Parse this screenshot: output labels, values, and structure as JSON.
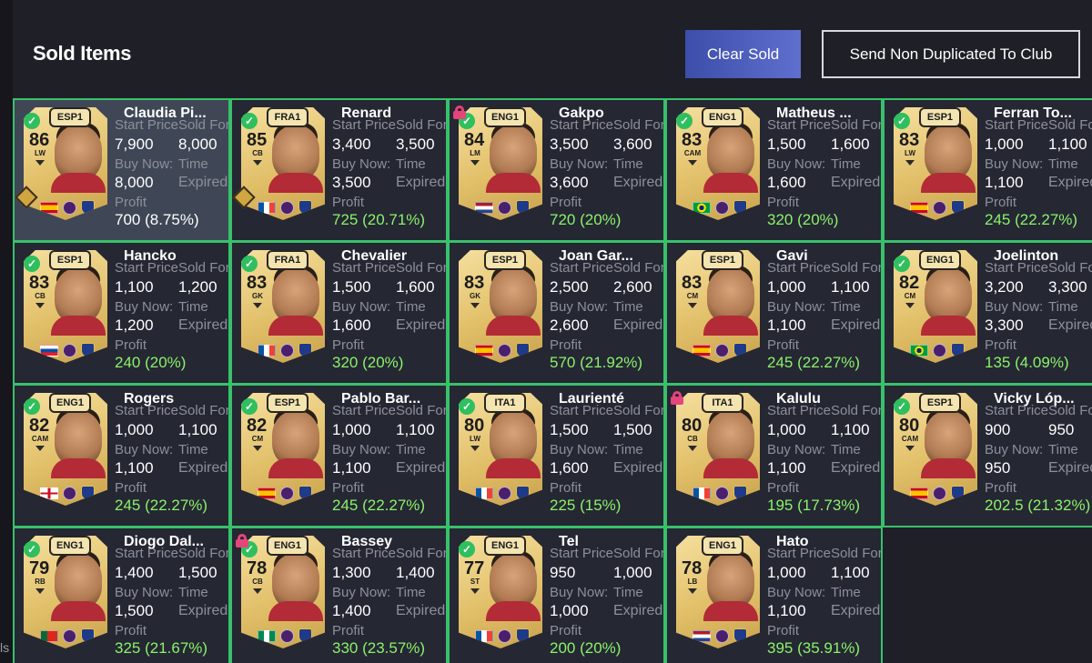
{
  "side_text": "ls",
  "title": "Sold Items",
  "buttons": {
    "clear_sold": "Clear Sold",
    "send_non_duplicated": "Send Non Duplicated To Club"
  },
  "labels": {
    "start_price": "Start Price",
    "sold_for": "Sold For",
    "buy_now": "Buy Now:",
    "time": "Time",
    "expired": "Expired",
    "profit": "Profit"
  },
  "colors": {
    "accent_border": "#38c16a",
    "profit_green": "#8af36a",
    "button_gradient_start": "#3b4ea8",
    "button_gradient_end": "#5f6fcf"
  },
  "items": [
    {
      "name": "Claudia Pi...",
      "league": "ESP1",
      "rating": "86",
      "pos": "LW",
      "start": "7,900",
      "sold": "8,000",
      "buy": "8,000",
      "profit": "700 (8.75%)",
      "profit_white": true,
      "selected": true,
      "check": true,
      "lock": false,
      "evo": true,
      "flags": [
        "es",
        "liga-f",
        "barca"
      ]
    },
    {
      "name": "Renard",
      "league": "FRA1",
      "rating": "85",
      "pos": "CB",
      "start": "3,400",
      "sold": "3,500",
      "buy": "3,500",
      "profit": "725 (20.71%)",
      "check": true,
      "evo": true,
      "flags": [
        "fr",
        "ligue",
        "lyon"
      ]
    },
    {
      "name": "Gakpo",
      "league": "ENG1",
      "rating": "84",
      "pos": "LM",
      "start": "3,500",
      "sold": "3,600",
      "buy": "3,600",
      "profit": "720 (20%)",
      "check": true,
      "lock": true,
      "flags": [
        "nl",
        "pl",
        "lfc"
      ]
    },
    {
      "name": "Matheus ...",
      "league": "ENG1",
      "rating": "83",
      "pos": "CAM",
      "start": "1,500",
      "sold": "1,600",
      "buy": "1,600",
      "profit": "320 (20%)",
      "check": true,
      "flags": [
        "br",
        "pl",
        "manu"
      ]
    },
    {
      "name": "Ferran To...",
      "league": "ESP1",
      "rating": "83",
      "pos": "LW",
      "start": "1,000",
      "sold": "1,100",
      "buy": "1,100",
      "profit": "245 (22.27%)",
      "check": true,
      "flags": [
        "es",
        "laliga",
        "barca"
      ]
    },
    {
      "name": "Hancko",
      "league": "ESP1",
      "rating": "83",
      "pos": "CB",
      "start": "1,100",
      "sold": "1,200",
      "buy": "1,200",
      "profit": "240 (20%)",
      "check": true,
      "flags": [
        "sk",
        "laliga",
        "atm"
      ]
    },
    {
      "name": "Chevalier",
      "league": "FRA1",
      "rating": "83",
      "pos": "GK",
      "start": "1,500",
      "sold": "1,600",
      "buy": "1,600",
      "profit": "320 (20%)",
      "check": true,
      "flags": [
        "fr",
        "ligue",
        "psg"
      ]
    },
    {
      "name": "Joan Gar...",
      "league": "ESP1",
      "rating": "83",
      "pos": "GK",
      "start": "2,500",
      "sold": "2,600",
      "buy": "2,600",
      "profit": "570 (21.92%)",
      "check": false,
      "flags": [
        "es",
        "laliga",
        "barca"
      ]
    },
    {
      "name": "Gavi",
      "league": "ESP1",
      "rating": "83",
      "pos": "CM",
      "start": "1,000",
      "sold": "1,100",
      "buy": "1,100",
      "profit": "245 (22.27%)",
      "check": false,
      "flags": [
        "es",
        "laliga",
        "barca"
      ]
    },
    {
      "name": "Joelinton",
      "league": "ENG1",
      "rating": "82",
      "pos": "CM",
      "start": "3,200",
      "sold": "3,300",
      "buy": "3,300",
      "profit": "135 (4.09%)",
      "check": true,
      "flags": [
        "br",
        "pl",
        "ncl"
      ]
    },
    {
      "name": "Rogers",
      "league": "ENG1",
      "rating": "82",
      "pos": "CAM",
      "start": "1,000",
      "sold": "1,100",
      "buy": "1,100",
      "profit": "245 (22.27%)",
      "check": true,
      "flags": [
        "en",
        "pl",
        "avl"
      ]
    },
    {
      "name": "Pablo Bar...",
      "league": "ESP1",
      "rating": "82",
      "pos": "CM",
      "start": "1,000",
      "sold": "1,100",
      "buy": "1,100",
      "profit": "245 (22.27%)",
      "check": true,
      "flags": [
        "es",
        "laliga",
        "atm"
      ]
    },
    {
      "name": "Laurienté",
      "league": "ITA1",
      "rating": "80",
      "pos": "LW",
      "start": "1,500",
      "sold": "1,500",
      "buy": "1,600",
      "profit": "225 (15%)",
      "check": true,
      "flags": [
        "fr",
        "serie",
        "sas"
      ]
    },
    {
      "name": "Kalulu",
      "league": "ITA1",
      "rating": "80",
      "pos": "CB",
      "start": "1,000",
      "sold": "1,100",
      "buy": "1,100",
      "profit": "195 (17.73%)",
      "check": false,
      "lock": true,
      "flags": [
        "fr",
        "serie",
        "juve"
      ]
    },
    {
      "name": "Vicky Lóp...",
      "league": "ESP1",
      "rating": "80",
      "pos": "CAM",
      "start": "900",
      "sold": "950",
      "buy": "950",
      "profit": "202.5 (21.32%)",
      "check": true,
      "flags": [
        "es",
        "liga-f",
        "barca"
      ]
    },
    {
      "name": "Diogo Dal...",
      "league": "ENG1",
      "rating": "79",
      "pos": "RB",
      "start": "1,400",
      "sold": "1,500",
      "buy": "1,500",
      "profit": "325 (21.67%)",
      "check": true,
      "flags": [
        "pt",
        "pl",
        "manu"
      ]
    },
    {
      "name": "Bassey",
      "league": "ENG1",
      "rating": "78",
      "pos": "CB",
      "start": "1,300",
      "sold": "1,400",
      "buy": "1,400",
      "profit": "330 (23.57%)",
      "check": true,
      "lock": true,
      "flags": [
        "ng",
        "pl",
        "ful"
      ]
    },
    {
      "name": "Tel",
      "league": "ENG1",
      "rating": "77",
      "pos": "ST",
      "start": "950",
      "sold": "1,000",
      "buy": "1,000",
      "profit": "200 (20%)",
      "check": true,
      "flags": [
        "fr",
        "pl",
        "tot"
      ]
    },
    {
      "name": "Hato",
      "league": "ENG1",
      "rating": "78",
      "pos": "LB",
      "start": "1,000",
      "sold": "1,100",
      "buy": "1,100",
      "profit": "395 (35.91%)",
      "check": false,
      "flags": [
        "nl",
        "pl",
        "che"
      ]
    }
  ]
}
